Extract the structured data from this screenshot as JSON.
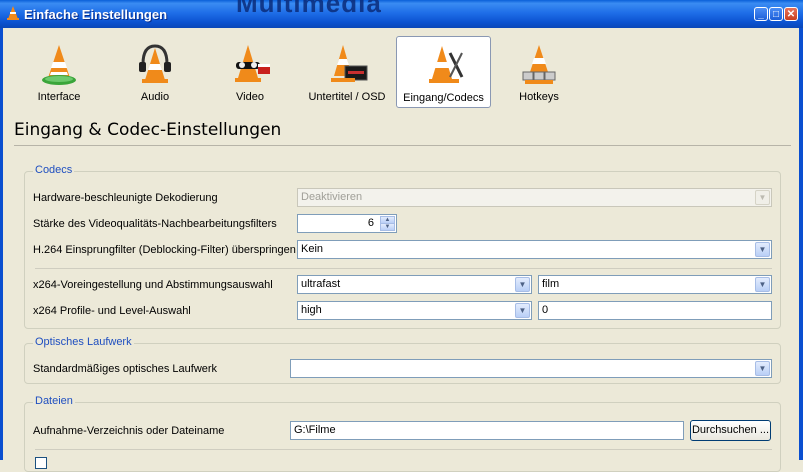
{
  "window": {
    "title": "Einfache Einstellungen",
    "background_text": "Multimedia"
  },
  "categories": [
    {
      "label": "Interface",
      "icon": "vlc-interface-icon",
      "selected": false
    },
    {
      "label": "Audio",
      "icon": "vlc-audio-icon",
      "selected": false
    },
    {
      "label": "Video",
      "icon": "vlc-video-icon",
      "selected": false
    },
    {
      "label": "Untertitel / OSD",
      "icon": "vlc-subtitles-icon",
      "selected": false
    },
    {
      "label": "Eingang/Codecs",
      "icon": "vlc-input-codecs-icon",
      "selected": true
    },
    {
      "label": "Hotkeys",
      "icon": "vlc-hotkeys-icon",
      "selected": false
    }
  ],
  "page_title": "Eingang & Codec-Einstellungen",
  "codecs": {
    "title": "Codecs",
    "hw_decoding": {
      "label": "Hardware-beschleunigte Dekodierung",
      "value": "Deaktivieren"
    },
    "pp_quality": {
      "label": "Stärke des Videoqualitäts-Nachbearbeitungsfilters",
      "value": "6"
    },
    "h264_loop": {
      "label": "H.264 Einsprungfilter (Deblocking-Filter) überspringen",
      "value": "Kein"
    },
    "x264_preset": {
      "label": "x264-Voreingestellung und Abstimmungsauswahl",
      "preset": "ultrafast",
      "tune": "film"
    },
    "x264_profile": {
      "label": "x264 Profile- und Level-Auswahl",
      "profile": "high",
      "level": "0"
    }
  },
  "optical": {
    "title": "Optisches Laufwerk",
    "default_drive": {
      "label": "Standardmäßiges optisches Laufwerk",
      "value": ""
    }
  },
  "files": {
    "title": "Dateien",
    "record_dir": {
      "label": "Aufnahme-Verzeichnis oder Dateiname",
      "value": "G:\\Filme"
    },
    "browse_label": "Durchsuchen ..."
  },
  "colors": {
    "titlebar": "#0b52d0",
    "group_title": "#1f4fc0",
    "dialog_bg": "#ece9d8"
  }
}
